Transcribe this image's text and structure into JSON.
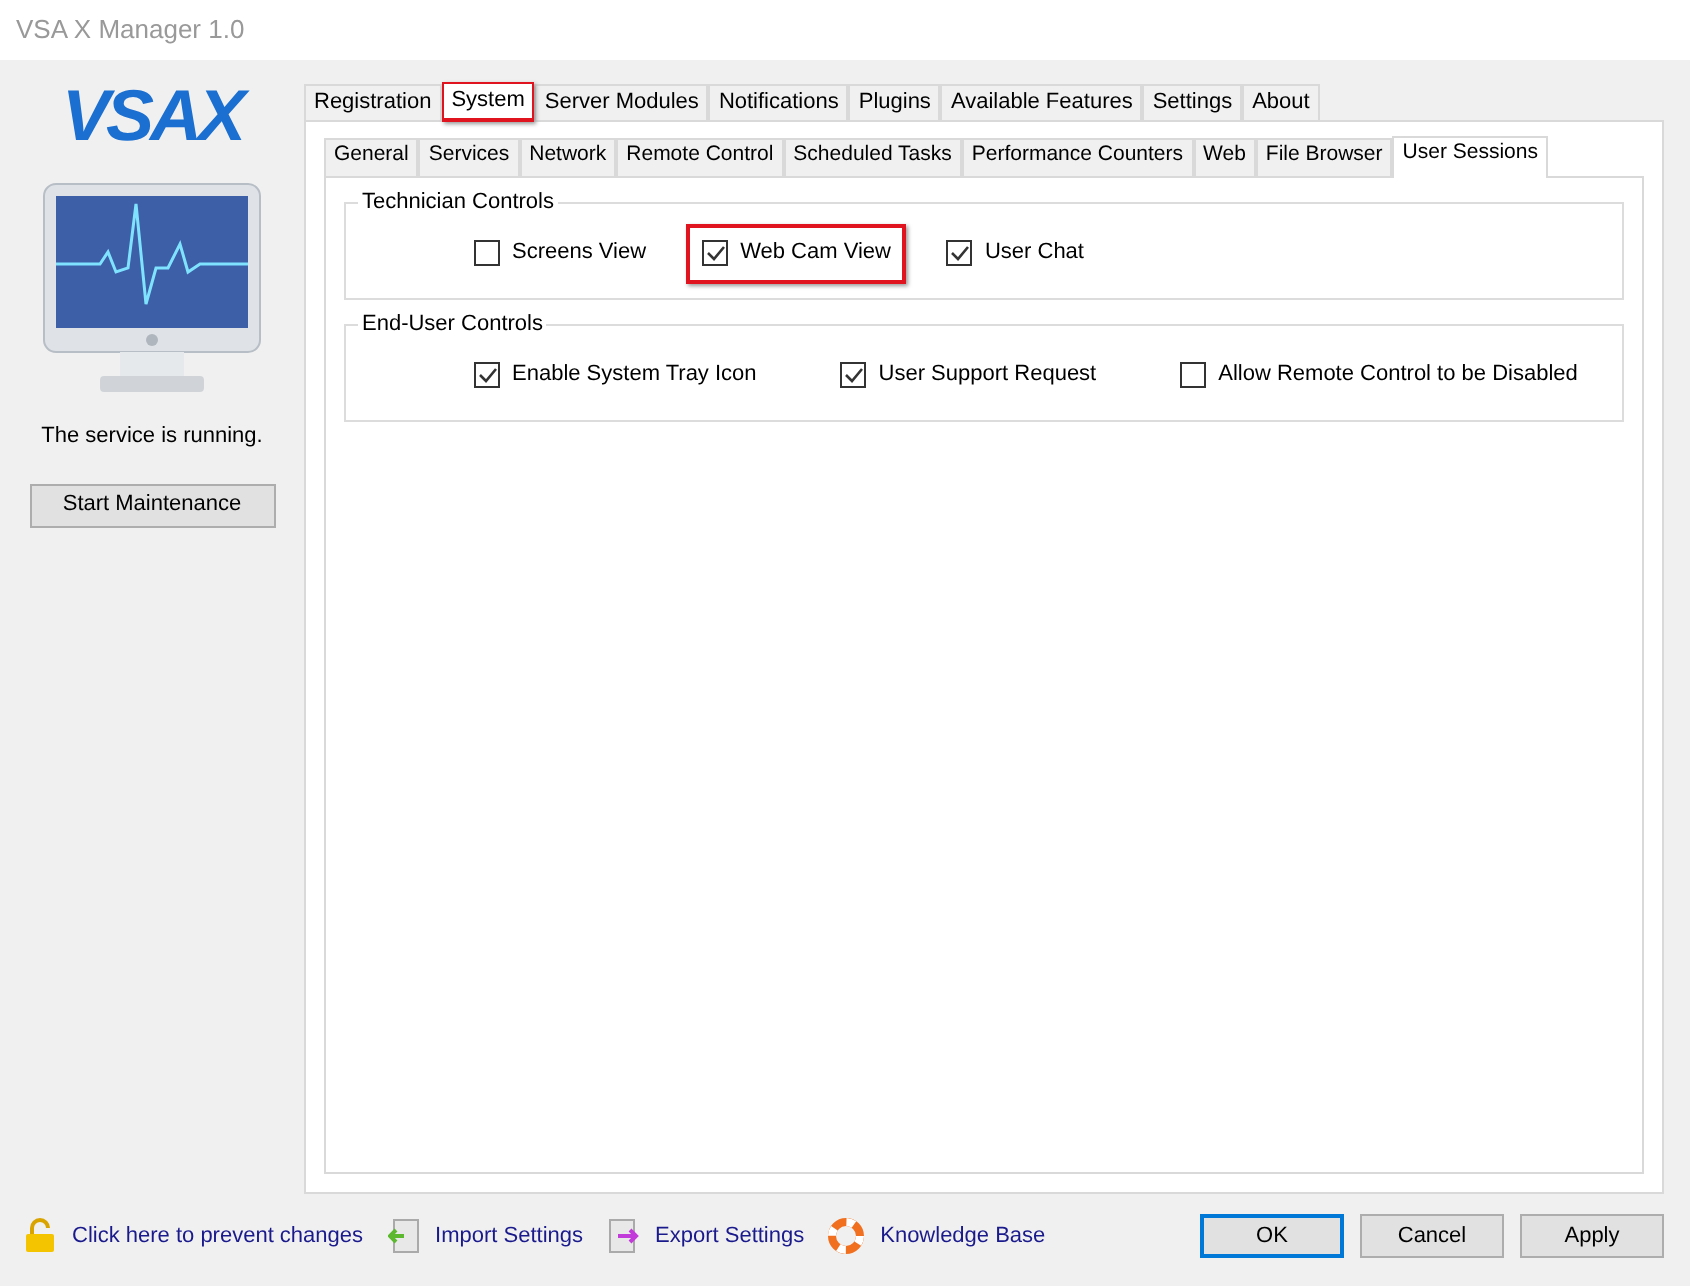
{
  "window": {
    "title": "VSA X Manager 1.0"
  },
  "sidebar": {
    "logo": "VSAX",
    "status": "The service is running.",
    "button": "Start Maintenance"
  },
  "tabs": [
    {
      "label": "Registration",
      "selected": false,
      "highlighted": false
    },
    {
      "label": "System",
      "selected": true,
      "highlighted": true
    },
    {
      "label": "Server Modules",
      "selected": false,
      "highlighted": false
    },
    {
      "label": "Notifications",
      "selected": false,
      "highlighted": false
    },
    {
      "label": "Plugins",
      "selected": false,
      "highlighted": false
    },
    {
      "label": "Available Features",
      "selected": false,
      "highlighted": false
    },
    {
      "label": "Settings",
      "selected": false,
      "highlighted": false
    },
    {
      "label": "About",
      "selected": false,
      "highlighted": false
    }
  ],
  "subtabs": [
    {
      "label": "General",
      "selected": false
    },
    {
      "label": "Services",
      "selected": false
    },
    {
      "label": "Network",
      "selected": false
    },
    {
      "label": "Remote Control",
      "selected": false
    },
    {
      "label": "Scheduled Tasks",
      "selected": false
    },
    {
      "label": "Performance Counters",
      "selected": false
    },
    {
      "label": "Web",
      "selected": false
    },
    {
      "label": "File Browser",
      "selected": false
    },
    {
      "label": "User Sessions",
      "selected": true
    }
  ],
  "groups": [
    {
      "title": "Technician Controls",
      "options": [
        {
          "label": "Screens View",
          "checked": false,
          "highlighted": false
        },
        {
          "label": "Web Cam View",
          "checked": true,
          "highlighted": true
        },
        {
          "label": "User Chat",
          "checked": true,
          "highlighted": false
        }
      ]
    },
    {
      "title": "End-User Controls",
      "options": [
        {
          "label": "Enable System Tray Icon",
          "checked": true,
          "highlighted": false
        },
        {
          "label": "User Support Request",
          "checked": true,
          "highlighted": false
        },
        {
          "label": "Allow Remote Control to be Disabled",
          "checked": false,
          "highlighted": false
        }
      ]
    }
  ],
  "footer_links": [
    {
      "kind": "lock",
      "label": "Click here to prevent changes"
    },
    {
      "kind": "import",
      "label": "Import Settings"
    },
    {
      "kind": "export",
      "label": "Export Settings"
    },
    {
      "kind": "help",
      "label": "Knowledge Base"
    }
  ],
  "buttons": [
    {
      "label": "OK",
      "default": true
    },
    {
      "label": "Cancel",
      "default": false
    },
    {
      "label": "Apply",
      "default": false
    }
  ]
}
